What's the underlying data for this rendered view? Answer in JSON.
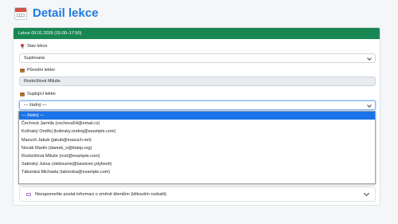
{
  "page": {
    "title": "Detail lekce"
  },
  "card": {
    "header": "Lekce 09.01.2026 (15:00–17:50)"
  },
  "fields": {
    "status": {
      "label": "Stav lekce",
      "value": "Suplovaná"
    },
    "original_lecturer": {
      "label": "Původní lektor",
      "value": "Roztočilová Miluše"
    },
    "substitute": {
      "label": "Suplující lektor",
      "value": "— žádný —"
    }
  },
  "dropdown": {
    "options": [
      "— žádný —",
      "Čechová Jarmila (cechova54@email.cz)",
      "Kolínský Ondřej (kolinsky.ondrej@example.com)",
      "Mazuch Jakub (jakub@mazuch.net)",
      "Novák Martin (damek_o@itstep.org)",
      "Roztočilová Miluše (rozt@example.com)",
      "Satinský Julius (steboume@bavisvet.ydybxeb)",
      "Táborská Michaela (taborska@example.com)"
    ]
  },
  "collapse": {
    "label": "Nezapomeňte poslat informaci o změně klientům (kliknutím rozbalit)"
  },
  "colors": {
    "header_green": "#198754",
    "title_blue": "#1f7ae0",
    "selected_blue": "#1a73e8"
  }
}
